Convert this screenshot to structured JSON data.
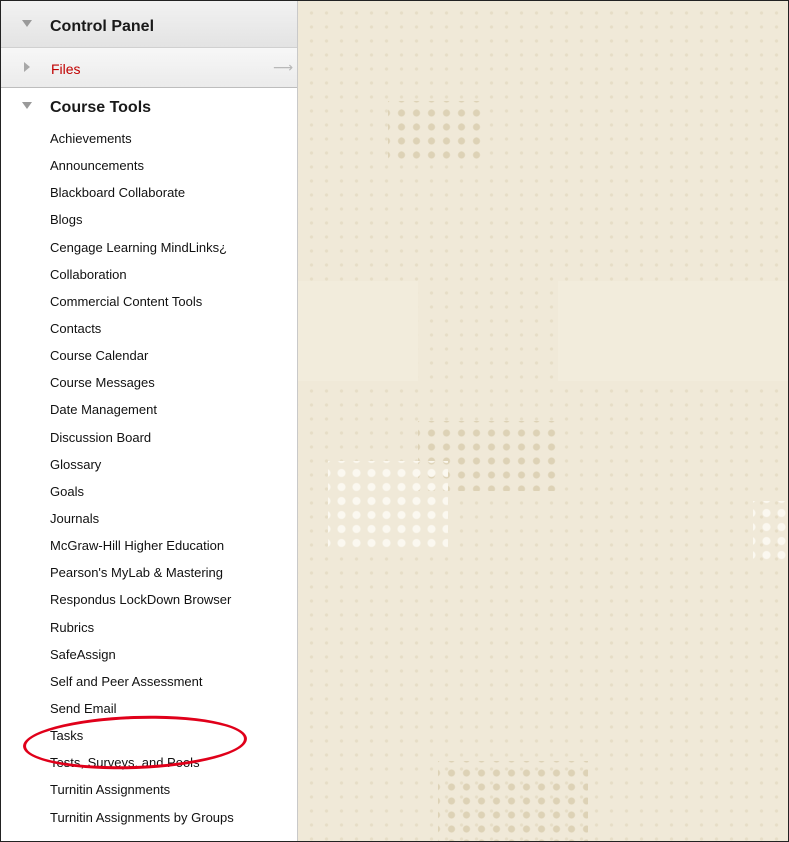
{
  "control_panel": {
    "title": "Control Panel"
  },
  "files": {
    "label": "Files",
    "go_arrow": "⟶"
  },
  "course_tools": {
    "title": "Course Tools",
    "items": [
      "Achievements",
      "Announcements",
      "Blackboard Collaborate",
      "Blogs",
      "Cengage Learning MindLinks¿",
      "Collaboration",
      "Commercial Content Tools",
      "Contacts",
      "Course Calendar",
      "Course Messages",
      "Date Management",
      "Discussion Board",
      "Glossary",
      "Goals",
      "Journals",
      "McGraw-Hill Higher Education",
      "Pearson's MyLab & Mastering",
      "Respondus LockDown Browser",
      "Rubrics",
      "SafeAssign",
      "Self and Peer Assessment",
      "Send Email",
      "Tasks",
      "Tests, Surveys, and Pools",
      "Turnitin Assignments",
      "Turnitin Assignments by Groups"
    ]
  },
  "colors": {
    "files_link": "#c00000",
    "highlight_ellipse": "#e0001a",
    "content_background": "#f0e9d8"
  },
  "icons": {
    "control_panel_toggle": "triangle-down-icon",
    "files_toggle": "triangle-right-icon",
    "course_tools_toggle": "triangle-down-icon",
    "files_go": "arrow-right-icon"
  }
}
